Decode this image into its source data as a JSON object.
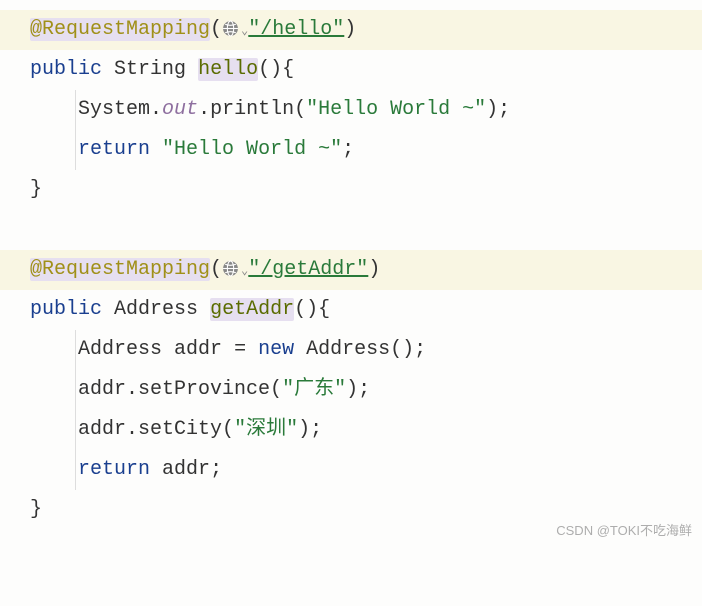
{
  "method1": {
    "annotation": "@RequestMapping",
    "url": "\"/hello\"",
    "public": "public",
    "return_type": "String",
    "name": "hello",
    "body": {
      "sysout_class": "System",
      "sysout_field": "out",
      "sysout_method": "println",
      "sysout_arg": "\"Hello World ~\"",
      "return_kw": "return",
      "return_val": "\"Hello World ~\""
    }
  },
  "method2": {
    "annotation": "@RequestMapping",
    "url": "\"/getAddr\"",
    "public": "public",
    "return_type": "Address",
    "name": "getAddr",
    "body": {
      "decl_type": "Address",
      "decl_var": "addr",
      "new_kw": "new",
      "new_type": "Address",
      "set1_call": "addr.setProvince",
      "set1_arg": "\"广东\"",
      "set2_call": "addr.setCity",
      "set2_arg": "\"深圳\"",
      "return_kw": "return",
      "return_val": "addr"
    }
  },
  "watermark": "CSDN @TOKI不吃海鲜"
}
